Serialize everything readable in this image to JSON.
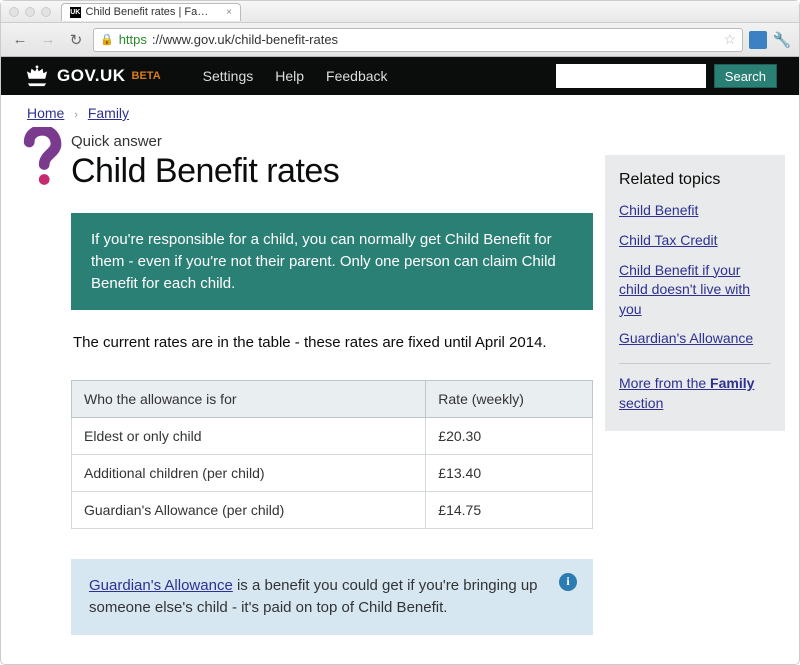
{
  "browser": {
    "tab_title": "Child Benefit rates | Family |",
    "tab_favicon_text": "UK",
    "url_scheme": "https",
    "url_rest": "://www.gov.uk/child-benefit-rates"
  },
  "header": {
    "site_title": "GOV.UK",
    "beta": "BETA",
    "nav": [
      "Settings",
      "Help",
      "Feedback"
    ],
    "search_button": "Search"
  },
  "breadcrumb": {
    "items": [
      "Home",
      "Family"
    ]
  },
  "page": {
    "supertitle": "Quick answer",
    "title": "Child Benefit rates",
    "intro": "If you're responsible for a child, you can normally get Child Benefit for them - even if you're not their parent. Only one person can claim Child Benefit for each child.",
    "body": "The current rates are in the table - these rates are fixed until April 2014.",
    "table": {
      "headers": [
        "Who the allowance is for",
        "Rate (weekly)"
      ],
      "rows": [
        [
          "Eldest or only child",
          "£20.30"
        ],
        [
          "Additional children (per child)",
          "£13.40"
        ],
        [
          "Guardian's Allowance (per child)",
          "£14.75"
        ]
      ]
    },
    "info_link": "Guardian's Allowance",
    "info_rest": " is a benefit you could get if you're bringing up someone else's child - it's paid on top of Child Benefit."
  },
  "sidebar": {
    "title": "Related topics",
    "links": [
      "Child Benefit",
      "Child Tax Credit",
      "Child Benefit if your child doesn't live with you",
      "Guardian's Allowance"
    ],
    "more_prefix": "More from the ",
    "more_bold": "Family",
    "more_suffix": " section"
  }
}
